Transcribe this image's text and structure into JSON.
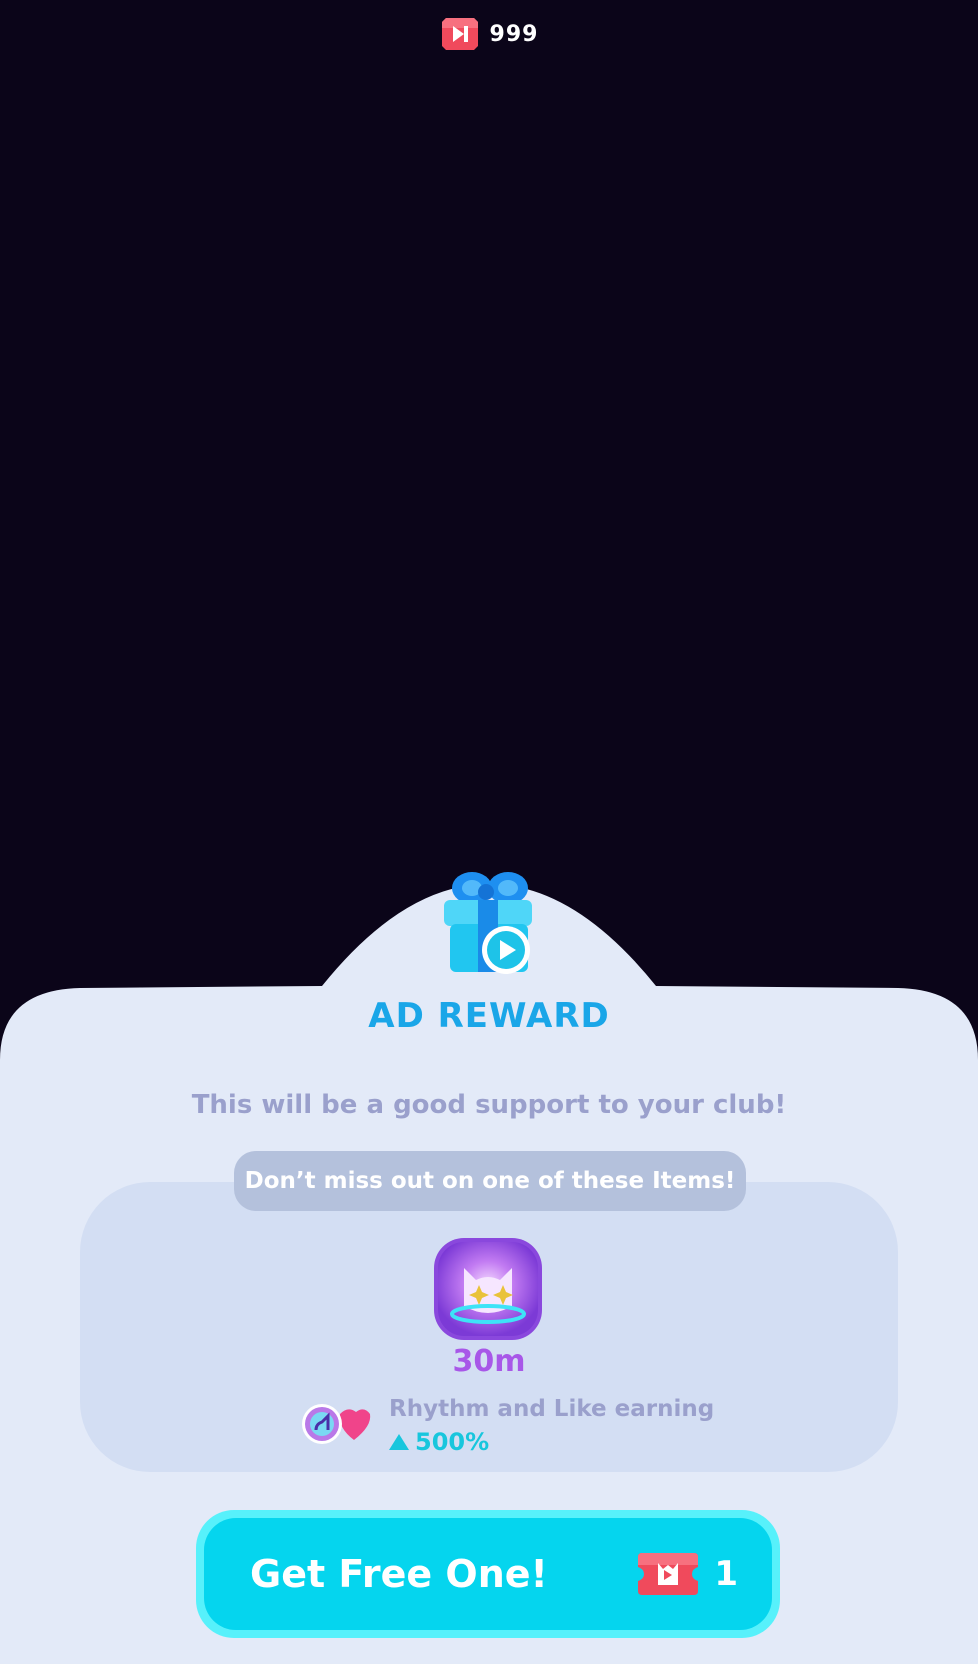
{
  "header": {
    "ticket_icon": "ad-ticket-icon",
    "ticket_count": "999"
  },
  "dialog": {
    "gift_icon": "gift-play-icon",
    "title": "AD REWARD",
    "subtitle": "This will be a good support to your club!",
    "items_heading": "Don’t miss out on one of these Items!",
    "item": {
      "icon": "cat-boost-icon",
      "duration": "30m",
      "effect_icon": "rhythm-like-icon",
      "effect_label": "Rhythm and Like earning",
      "effect_value": "500%"
    },
    "cta": {
      "label": "Get Free One!",
      "cost_icon": "ad-ticket-icon",
      "cost": "1"
    }
  },
  "colors": {
    "background": "#0b0519",
    "sheet": "#e3eaf8",
    "panel": "#d3def3",
    "title": "#1aa6e8",
    "accent_cyan": "#05d5ee",
    "purple": "#a857e8",
    "ticket_red": "#f04a5c"
  }
}
